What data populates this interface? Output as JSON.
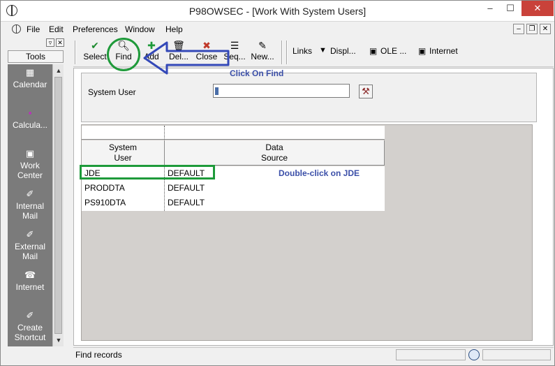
{
  "window": {
    "title": "P98OWSEC - [Work With System Users]",
    "close_glyph": "✕",
    "min_glyph": "–",
    "max_glyph": "☐"
  },
  "menu": {
    "items": [
      "File",
      "Edit",
      "Preferences",
      "Window",
      "Help"
    ],
    "mdi_min": "–",
    "mdi_restore": "❐",
    "mdi_close": "✕"
  },
  "tools": {
    "top_restore": "▿",
    "top_close": "✕",
    "header": "Tools",
    "items": [
      {
        "label": "Calendar",
        "icon": "calendar-icon",
        "glyph": "▦"
      },
      {
        "label": "Calcula...",
        "icon": "calculator-icon",
        "glyph": "▪"
      },
      {
        "label": "Work Center",
        "icon": "work-center-icon",
        "glyph": "▣"
      },
      {
        "label": "Internal Mail",
        "icon": "internal-mail-icon",
        "glyph": "✐"
      },
      {
        "label": "External Mail",
        "icon": "external-mail-icon",
        "glyph": "✐"
      },
      {
        "label": "Internet",
        "icon": "internet-icon",
        "glyph": "☎"
      },
      {
        "label": "Create Shortcut",
        "icon": "shortcut-icon",
        "glyph": "✐"
      }
    ],
    "scroll_up": "▲",
    "scroll_down": "▼"
  },
  "toolbar": {
    "select": {
      "label": "Select",
      "glyph": "✔",
      "color": "#1c8a2e"
    },
    "find": {
      "label": "Find",
      "glyph": "🔍︎",
      "color": "#333333"
    },
    "add": {
      "label": "Add",
      "glyph": "✚",
      "color": "#1e9a3a"
    },
    "delete": {
      "label": "Del...",
      "glyph": "🗑︎",
      "color": "#444444"
    },
    "close": {
      "label": "Close",
      "glyph": "✖",
      "color": "#c0392b"
    },
    "seq": {
      "label": "Seq...",
      "glyph": "☰",
      "color": "#333333"
    },
    "new": {
      "label": "New...",
      "glyph": "✎",
      "color": "#333333"
    },
    "links": "Links",
    "display": "Displ...",
    "display_glyph": "▼",
    "ole": "OLE ...",
    "ole_glyph": "▣",
    "internet": "Internet",
    "internet_glyph": "▣"
  },
  "criteria": {
    "label": "System User",
    "value": "",
    "visual_assist_glyph": "⚒"
  },
  "grid": {
    "columns": [
      {
        "line1": "System",
        "line2": "User"
      },
      {
        "line1": "Data",
        "line2": "Source"
      }
    ],
    "rows": [
      {
        "user": "JDE",
        "source": "DEFAULT"
      },
      {
        "user": "PRODDTA",
        "source": "DEFAULT"
      },
      {
        "user": "PS910DTA",
        "source": "DEFAULT"
      }
    ]
  },
  "status": {
    "text": "Find records"
  },
  "annotations": {
    "find_note": "Click On Find",
    "row_note": "Double-click on JDE",
    "accent": "#1e9a3a",
    "note_color": "#3b4fa8"
  }
}
